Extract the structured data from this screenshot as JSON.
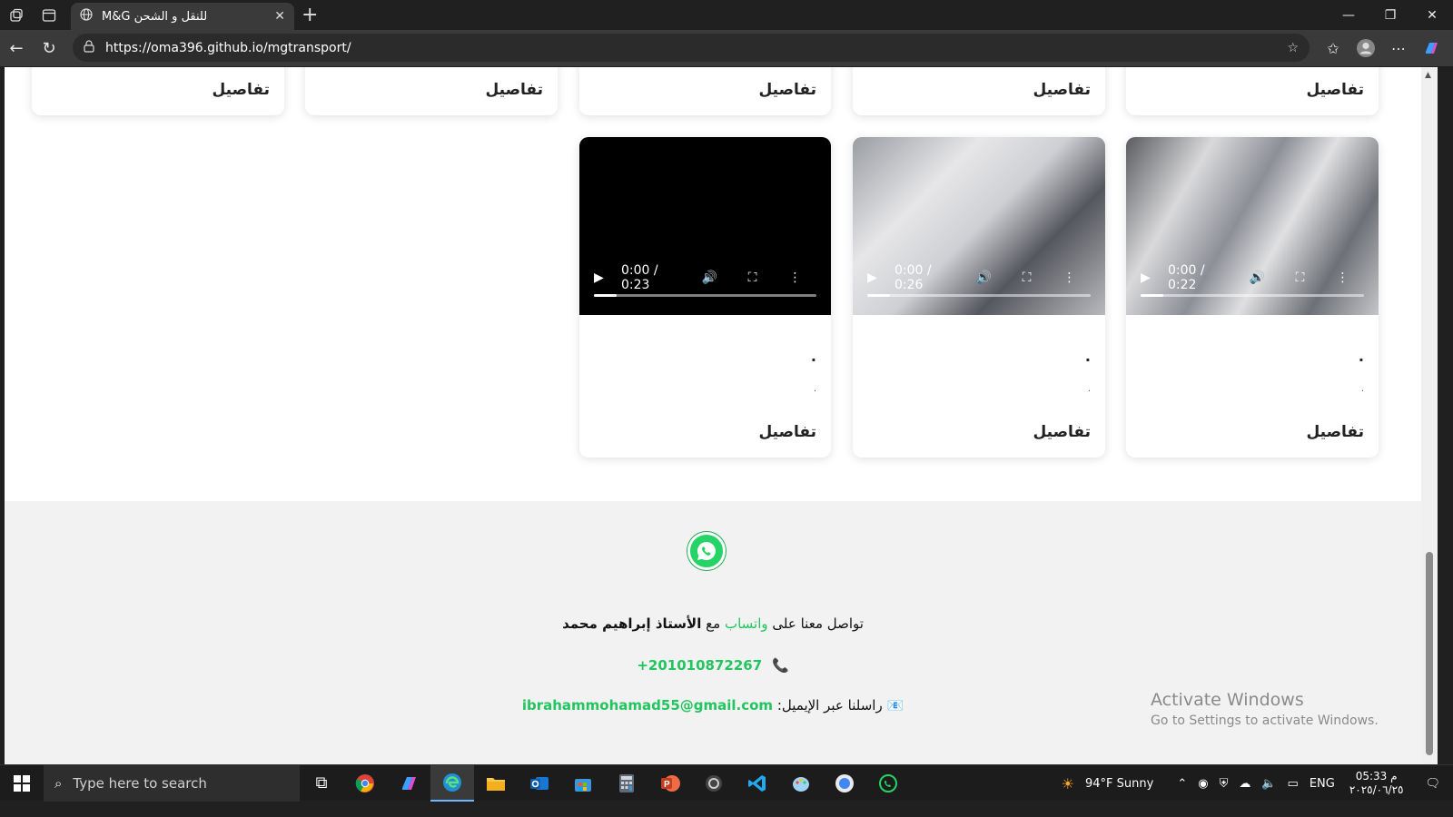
{
  "browser": {
    "tab_title": "للنقل و الشحن M&G",
    "url": "https://oma396.github.io/mgtransport/"
  },
  "cards_top": [
    {
      "details": "تفاصيل"
    },
    {
      "details": "تفاصيل"
    },
    {
      "details": "تفاصيل"
    },
    {
      "details": "تفاصيل"
    },
    {
      "details": "تفاصيل"
    }
  ],
  "cards_video": [
    {
      "time": "0:00 / 0:23",
      "title_dot": ".",
      "subtitle_dot": ".",
      "details": "تفاصيل",
      "progress": 0.1
    },
    {
      "time": "0:00 / 0:26",
      "title_dot": ".",
      "subtitle_dot": ".",
      "details": "تفاصيل",
      "progress": 0.1
    },
    {
      "time": "0:00 / 0:22",
      "title_dot": ".",
      "subtitle_dot": ".",
      "details": "تفاصيل",
      "progress": 0.1
    }
  ],
  "footer": {
    "contact_prefix": "تواصل معنا على",
    "whatsapp_word": "واتساب",
    "with_word": "مع",
    "person": "الأستاذ إبراهيم محمد",
    "phone": "+201010872267",
    "email_label": "راسلنا عبر الإيميل:",
    "email": "ibrahammohamad55@gmail.com"
  },
  "watermark": {
    "line1": "Activate Windows",
    "line2": "Go to Settings to activate Windows."
  },
  "taskbar": {
    "search_placeholder": "Type here to search",
    "weather": "94°F  Sunny",
    "lang": "ENG",
    "time": "05:33 م",
    "date": "٢٠٢٥/٠٦/٢٥"
  },
  "colors": {
    "accent_green": "#22c55e",
    "whatsapp_green": "#25d366",
    "phone_red": "#c0392b"
  }
}
